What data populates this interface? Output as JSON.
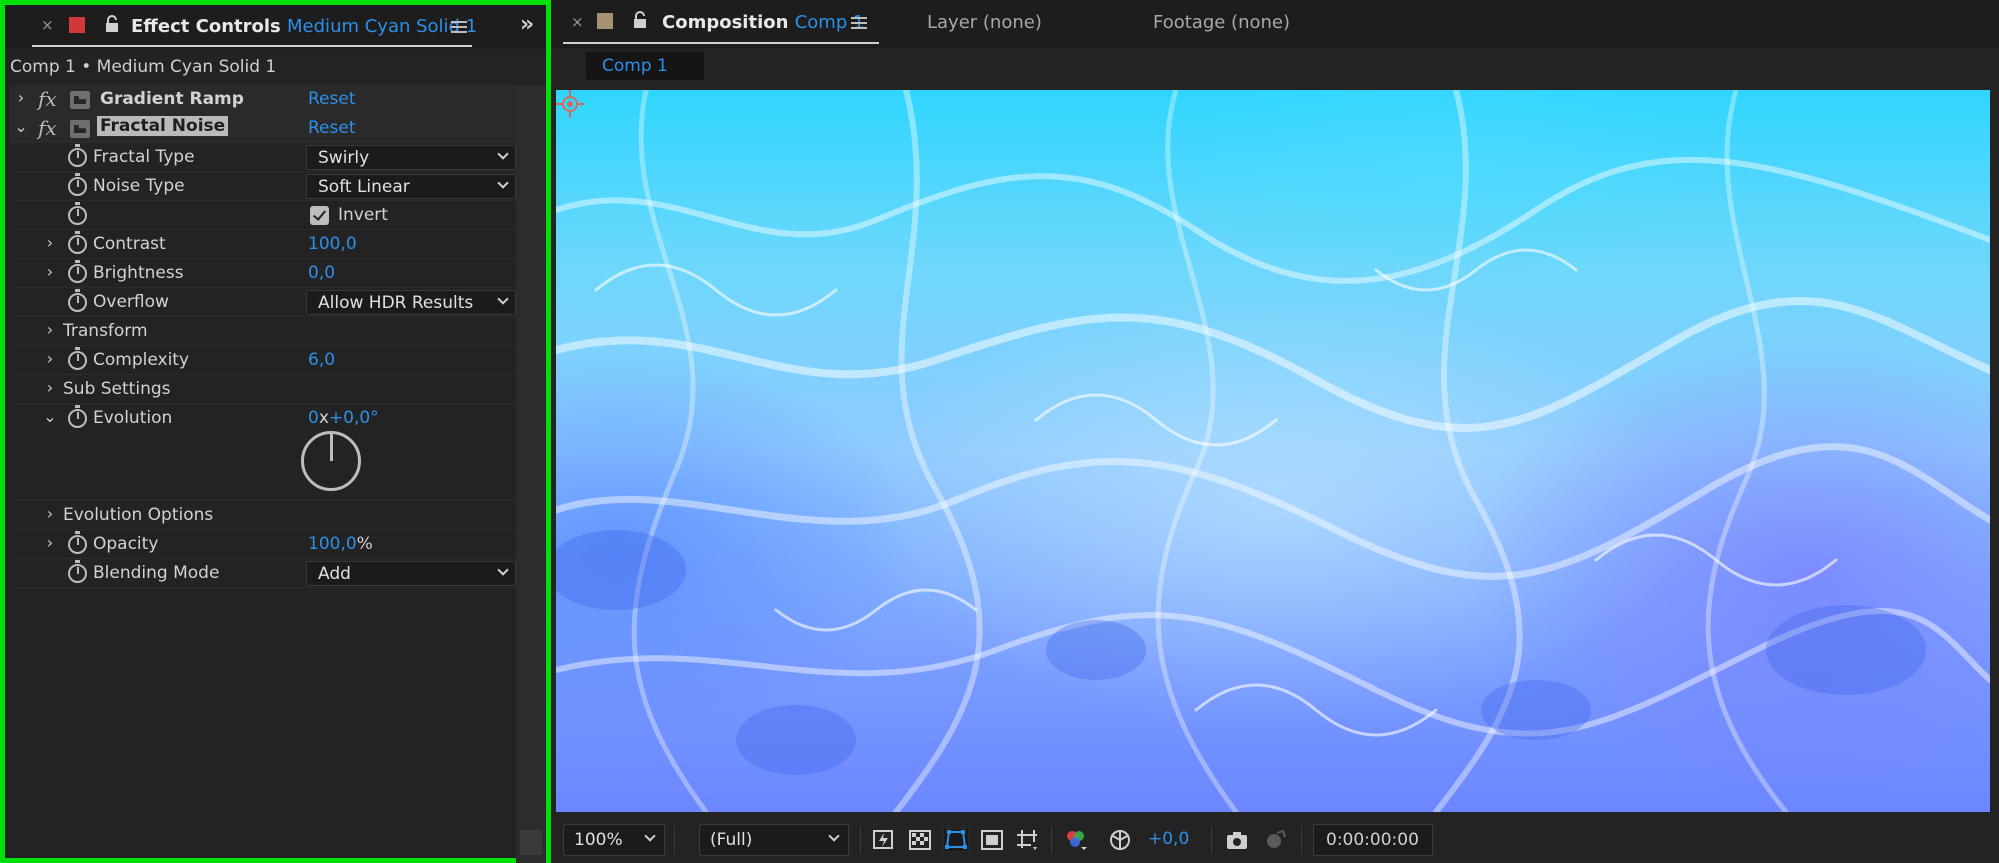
{
  "effect_controls": {
    "close": "×",
    "swatch_color": "#d0383b",
    "tab_label": "Effect Controls",
    "tab_layer": "Medium Cyan Solid 1",
    "collapse_glyph": "»",
    "breadcrumb": "Comp 1 • Medium Cyan Solid 1",
    "effects": [
      {
        "fx": "fx",
        "name": "Gradient Ramp",
        "reset": "Reset"
      },
      {
        "fx": "fx",
        "name": "Fractal Noise",
        "reset": "Reset"
      }
    ],
    "params": {
      "fractal_type": {
        "label": "Fractal Type",
        "value": "Swirly"
      },
      "noise_type": {
        "label": "Noise Type",
        "value": "Soft Linear"
      },
      "invert": {
        "label": "Invert",
        "checked": true
      },
      "contrast": {
        "label": "Contrast",
        "value": "100,0"
      },
      "brightness": {
        "label": "Brightness",
        "value": "0,0"
      },
      "overflow": {
        "label": "Overflow",
        "value": "Allow HDR Results"
      },
      "transform": {
        "label": "Transform"
      },
      "complexity": {
        "label": "Complexity",
        "value": "6,0"
      },
      "sub_settings": {
        "label": "Sub Settings"
      },
      "evolution": {
        "label": "Evolution",
        "revolutions": "0",
        "x": "x",
        "degrees": "+0,0°"
      },
      "evolution_options": {
        "label": "Evolution Options"
      },
      "opacity": {
        "label": "Opacity",
        "value": "100,0",
        "unit": "%"
      },
      "blending_mode": {
        "label": "Blending Mode",
        "value": "Add"
      }
    }
  },
  "composition": {
    "close": "×",
    "swatch_color": "#a89274",
    "tab_label": "Composition",
    "tab_comp": "Comp 1",
    "layer_tab": "Layer (none)",
    "footage_tab": "Footage (none)",
    "subtab": "Comp 1",
    "bottom": {
      "zoom": "100%",
      "resolution": "(Full)",
      "exposure": "+0,0",
      "timecode": "0:00:00:00"
    },
    "icons": [
      "fast-previews-icon",
      "transparency-grid-icon",
      "mask-visibility-icon",
      "region-of-interest-icon",
      "guides-icon",
      "color-channels-icon",
      "reset-exposure-icon",
      "snapshot-icon",
      "show-snapshot-icon"
    ]
  },
  "accent_color": "#2e8fe8",
  "highlight_color": "#00e00b"
}
